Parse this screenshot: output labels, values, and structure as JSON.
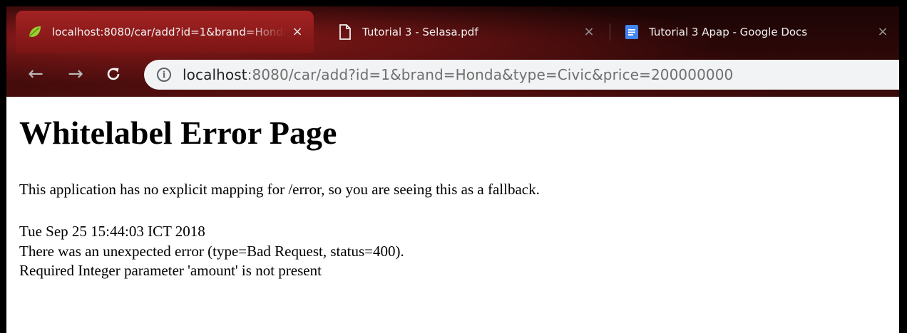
{
  "browser": {
    "tabs": [
      {
        "title": "localhost:8080/car/add?id=1&brand=Honda&type=Civic&price=200000000",
        "icon": "spring-leaf-icon",
        "active": true,
        "close": "×"
      },
      {
        "title": "Tutorial 3 - Selasa.pdf",
        "icon": "document-icon",
        "active": false,
        "close": "×"
      },
      {
        "title": "Tutorial 3 Apap - Google Docs",
        "icon": "google-docs-icon",
        "active": false,
        "close": "×"
      }
    ],
    "nav": {
      "back": "←",
      "forward": "→",
      "reload": "C"
    },
    "address": {
      "info_glyph": "i",
      "host": "localhost",
      "rest": ":8080/car/add?id=1&brand=Honda&type=Civic&price=200000000"
    },
    "colors": {
      "tab_active": "#a32222",
      "omnibox": "#f1f3f4",
      "docs_blue": "#4285f4",
      "spring_green": "#6db33f"
    }
  },
  "page": {
    "heading": "Whitelabel Error Page",
    "message": "This application has no explicit mapping for /error, so you are seeing this as a fallback.",
    "timestamp": "Tue Sep 25 15:44:03 ICT 2018",
    "error_line": "There was an unexpected error (type=Bad Request, status=400).",
    "detail": "Required Integer parameter 'amount' is not present"
  }
}
